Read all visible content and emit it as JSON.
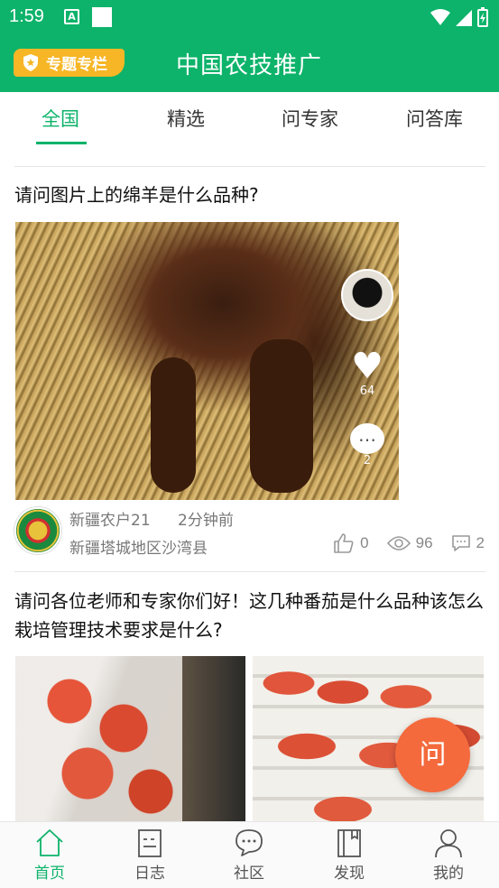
{
  "status_bar": {
    "time": "1:59",
    "notif_a": "A"
  },
  "app_bar": {
    "special_label": "专题专栏",
    "title": "中国农技推广"
  },
  "tabs": [
    {
      "label": "全国",
      "active": true
    },
    {
      "label": "精选",
      "active": false
    },
    {
      "label": "问专家",
      "active": false
    },
    {
      "label": "问答库",
      "active": false
    }
  ],
  "posts": [
    {
      "title": "请问图片上的绵羊是什么品种?",
      "image_overlay": {
        "likes": "64",
        "comments": "2"
      },
      "author": "新疆农户21",
      "time": "2分钟前",
      "location": "新疆塔城地区沙湾县",
      "stats": {
        "likes": "0",
        "views": "96",
        "comments": "2"
      }
    },
    {
      "title": "请问各位老师和专家你们好！这几种番茄是什么品种该怎么栽培管理技术要求是什么?"
    }
  ],
  "fab_label": "问",
  "bottom_nav": [
    {
      "label": "首页",
      "icon": "home-icon",
      "active": true
    },
    {
      "label": "日志",
      "icon": "journal-icon",
      "active": false
    },
    {
      "label": "社区",
      "icon": "chat-icon",
      "active": false
    },
    {
      "label": "发现",
      "icon": "book-icon",
      "active": false
    },
    {
      "label": "我的",
      "icon": "person-icon",
      "active": false
    }
  ],
  "colors": {
    "primary": "#0db36a",
    "accent": "#f7b626",
    "fab": "#f46a3d"
  }
}
